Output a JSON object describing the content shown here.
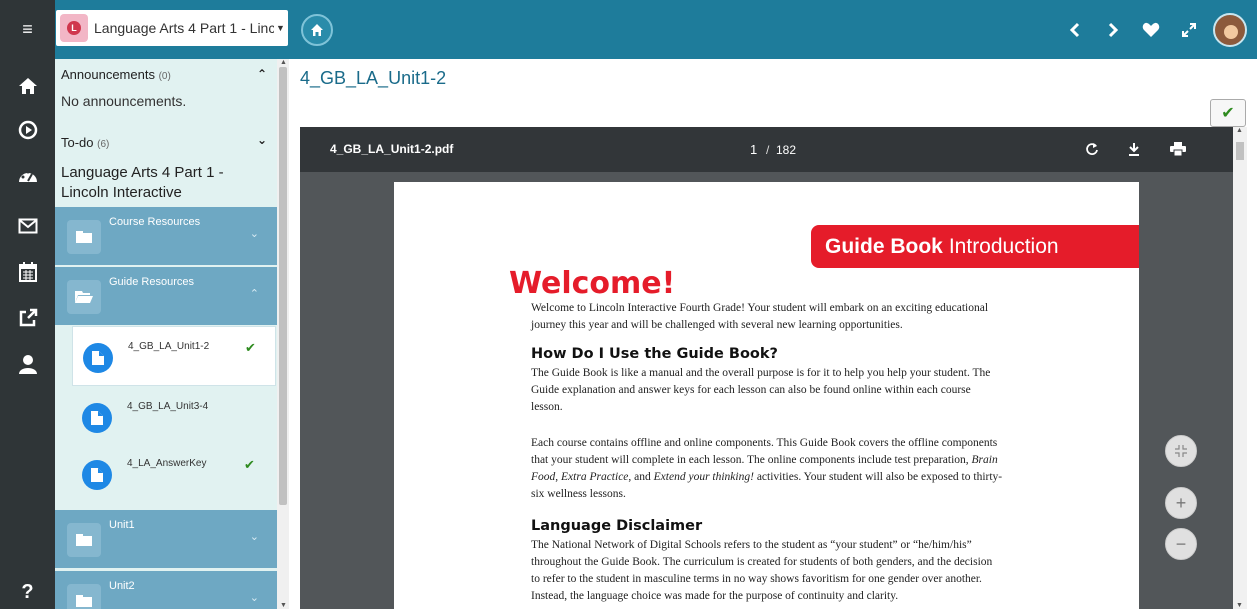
{
  "topbar": {
    "course_title": "Language Arts 4 Part 1 - Linc...",
    "accent": "#1e7c9b"
  },
  "sidebar": {
    "announcements_label": "Announcements",
    "announcements_count": "(0)",
    "no_announcements": "No announcements.",
    "todo_label": "To-do",
    "todo_count": "(6)",
    "course_name": "Language Arts 4 Part 1 - Lincoln Interactive",
    "folders": [
      {
        "label": "Course Resources"
      },
      {
        "label": "Guide Resources"
      },
      {
        "label": "Unit1"
      },
      {
        "label": "Unit2"
      }
    ],
    "files": [
      {
        "label": "4_GB_LA_Unit1-2",
        "done": true
      },
      {
        "label": "4_GB_LA_Unit3-4",
        "done": false
      },
      {
        "label": "4_LA_AnswerKey",
        "done": true
      }
    ]
  },
  "main": {
    "title": "4_GB_LA_Unit1-2"
  },
  "viewer": {
    "filename": "4_GB_LA_Unit1-2.pdf",
    "page_current": "1",
    "page_sep": "/",
    "page_total": "182"
  },
  "pdf": {
    "banner_bold": "Guide Book",
    "banner_rest": "Introduction",
    "welcome": "Welcome!",
    "p1_l1": "Welcome to Lincoln Interactive Fourth Grade! Your student will embark on an exciting educational",
    "p1_l2": "journey this year and will be challenged with several new learning opportunities.",
    "h_guide": "How Do I Use the Guide Book?",
    "p2_l1": "The Guide Book is like a manual and the overall purpose is for it to help you help your student. The",
    "p2_l2": "Guide explanation and answer keys for each lesson can also be found online within each course",
    "p2_l3": "lesson.",
    "p3_l1": "Each course contains offline and online components. This Guide Book covers the offline components",
    "p3_l2a": "that your student will complete in each lesson. The online components include test preparation, ",
    "p3_l2b": "Brain",
    "p3_l3a": "Food",
    "p3_l3b": ", ",
    "p3_l3c": "Extra Practice",
    "p3_l3d": ", and ",
    "p3_l3e": "Extend your thinking!",
    "p3_l3f": " activities. Your student will also be exposed to thirty-",
    "p3_l4": "six wellness lessons.",
    "h_lang": "Language Disclaimer",
    "p4_l1": "The National Network of Digital Schools refers to the student as “your student” or “he/him/his”",
    "p4_l2": "throughout the Guide Book. The curriculum is created for students of both genders, and the decision",
    "p4_l3": "to refer to the student in masculine terms in no way shows favoritism for one gender over another.",
    "p4_l4": "Instead, the language choice was made for the purpose of continuity and clarity."
  },
  "icons": {
    "menu": "hamburger-icon",
    "home": "home-icon",
    "prev": "chevron-left-icon",
    "next": "chevron-right-icon",
    "favorite": "heart-icon",
    "expand": "expand-icon"
  }
}
